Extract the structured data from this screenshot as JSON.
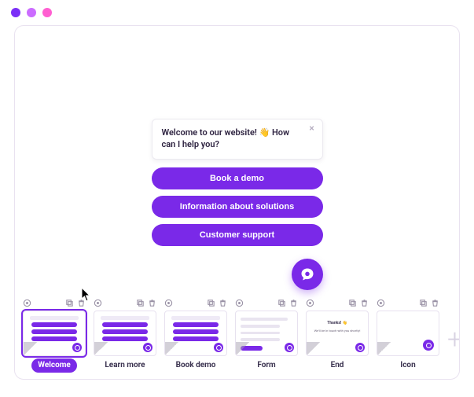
{
  "titlebar": {
    "dotColors": [
      "#7b2ff7",
      "#cb6cff",
      "#ff5fd1"
    ]
  },
  "chat": {
    "welcome_prefix": "Welcome to our website! ",
    "welcome_emoji": "👋",
    "welcome_suffix": "  How can I help you?",
    "options": [
      {
        "label": "Book a demo"
      },
      {
        "label": "Information about solutions"
      },
      {
        "label": "Customer support"
      }
    ],
    "close_glyph": "×"
  },
  "thumbs": [
    {
      "label": "Welcome",
      "kind": "welcome",
      "selected": true
    },
    {
      "label": "Learn more",
      "kind": "options",
      "selected": false
    },
    {
      "label": "Book demo",
      "kind": "options",
      "selected": false
    },
    {
      "label": "Form",
      "kind": "form",
      "selected": false
    },
    {
      "label": "End",
      "kind": "end",
      "selected": false,
      "end_title": "Thanks!",
      "end_sub": "We'll be in touch with you shortly!"
    },
    {
      "label": "Icon",
      "kind": "icon",
      "selected": false
    }
  ],
  "add_glyph": "+"
}
